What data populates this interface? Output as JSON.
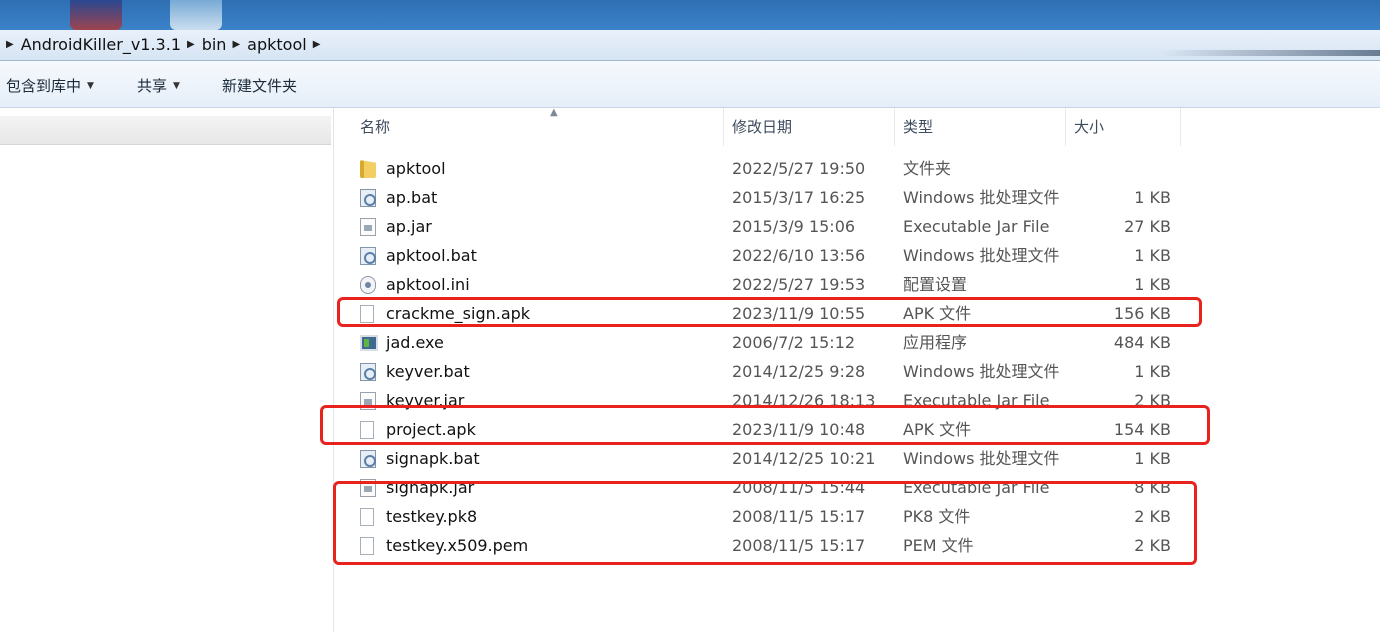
{
  "address": {
    "crumbs": [
      "AndroidKiller_v1.3.1",
      "bin",
      "apktool"
    ]
  },
  "toolbar": {
    "include_library": "包含到库中",
    "share": "共享",
    "new_folder": "新建文件夹"
  },
  "columns": {
    "name": "名称",
    "date": "修改日期",
    "type": "类型",
    "size": "大小"
  },
  "files": [
    {
      "name": "apktool",
      "date": "2022/5/27 19:50",
      "type": "文件夹",
      "size": "",
      "icon": "folder-icon"
    },
    {
      "name": "ap.bat",
      "date": "2015/3/17 16:25",
      "type": "Windows 批处理文件",
      "size": "1 KB",
      "icon": "batch-file-icon"
    },
    {
      "name": "ap.jar",
      "date": "2015/3/9 15:06",
      "type": "Executable Jar File",
      "size": "27 KB",
      "icon": "jar-file-icon"
    },
    {
      "name": "apktool.bat",
      "date": "2022/6/10 13:56",
      "type": "Windows 批处理文件",
      "size": "1 KB",
      "icon": "batch-file-icon"
    },
    {
      "name": "apktool.ini",
      "date": "2022/5/27 19:53",
      "type": "配置设置",
      "size": "1 KB",
      "icon": "settings-file-icon"
    },
    {
      "name": "crackme_sign.apk",
      "date": "2023/11/9 10:55",
      "type": "APK 文件",
      "size": "156 KB",
      "icon": "blank-file-icon"
    },
    {
      "name": "jad.exe",
      "date": "2006/7/2 15:12",
      "type": "应用程序",
      "size": "484 KB",
      "icon": "exe-file-icon"
    },
    {
      "name": "keyver.bat",
      "date": "2014/12/25 9:28",
      "type": "Windows 批处理文件",
      "size": "1 KB",
      "icon": "batch-file-icon"
    },
    {
      "name": "keyver.jar",
      "date": "2014/12/26 18:13",
      "type": "Executable Jar File",
      "size": "2 KB",
      "icon": "jar-file-icon"
    },
    {
      "name": "project.apk",
      "date": "2023/11/9 10:48",
      "type": "APK 文件",
      "size": "154 KB",
      "icon": "blank-file-icon"
    },
    {
      "name": "signapk.bat",
      "date": "2014/12/25 10:21",
      "type": "Windows 批处理文件",
      "size": "1 KB",
      "icon": "batch-file-icon"
    },
    {
      "name": "signapk.jar",
      "date": "2008/11/5 15:44",
      "type": "Executable Jar File",
      "size": "8 KB",
      "icon": "jar-file-icon"
    },
    {
      "name": "testkey.pk8",
      "date": "2008/11/5 15:17",
      "type": "PK8 文件",
      "size": "2 KB",
      "icon": "blank-file-icon"
    },
    {
      "name": "testkey.x509.pem",
      "date": "2008/11/5 15:17",
      "type": "PEM 文件",
      "size": "2 KB",
      "icon": "blank-file-icon"
    }
  ],
  "colors": {
    "highlight": "#e8231d",
    "title_strip": "#3b82c8"
  }
}
